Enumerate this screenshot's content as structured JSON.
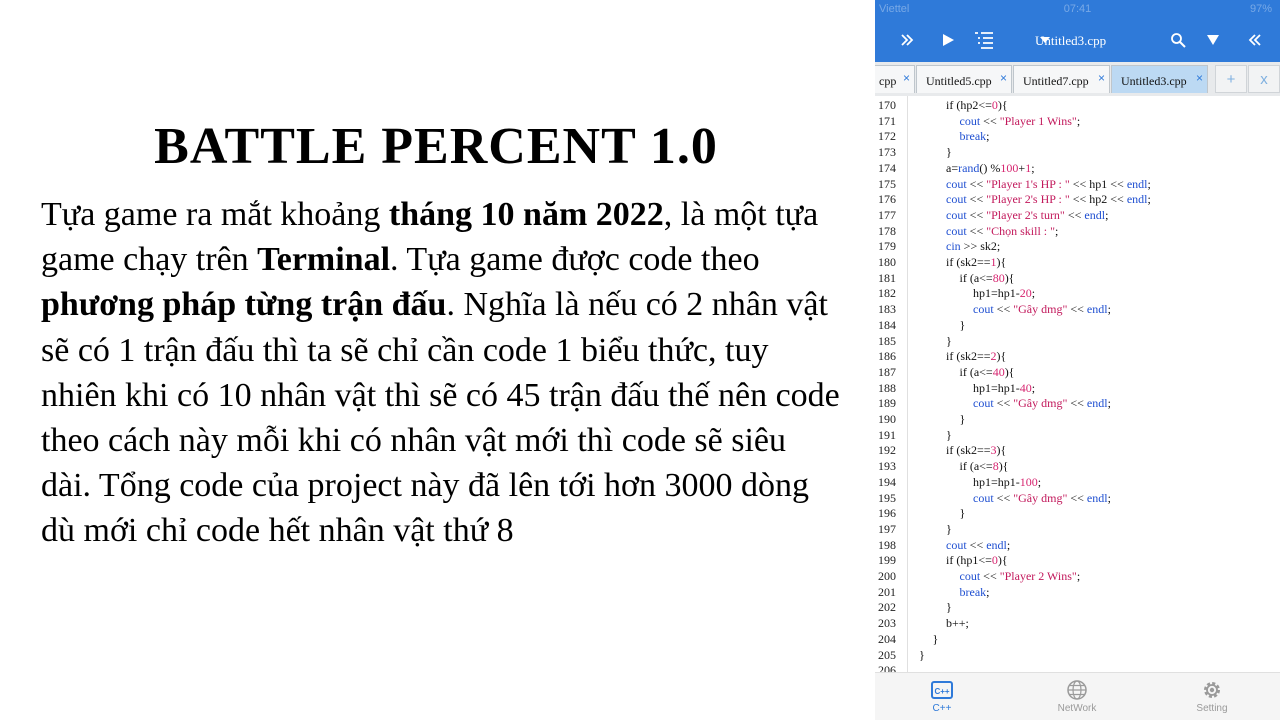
{
  "slide": {
    "title": "BATTLE PERCENT 1.0",
    "body": [
      {
        "text": "Tựa game ra mắt khoảng ",
        "bold": false
      },
      {
        "text": "tháng 10 năm 2022",
        "bold": true
      },
      {
        "text": ", là một tựa game chạy trên ",
        "bold": false
      },
      {
        "text": "Terminal",
        "bold": true
      },
      {
        "text": ". Tựa game được code theo ",
        "bold": false
      },
      {
        "text": "phương pháp từng trận đấu",
        "bold": true
      },
      {
        "text": ". Nghĩa là nếu có 2 nhân vật sẽ có 1 trận đấu thì ta sẽ chỉ cần code 1 biểu thức, tuy nhiên khi có 10 nhân vật thì sẽ có 45 trận đấu thế nên code theo cách này mỗi khi có nhân vật mới thì code sẽ siêu dài. Tổng code của project này đã lên tới hơn 3000 dòng dù mới chỉ code hết nhân vật thứ 8",
        "bold": false
      }
    ]
  },
  "status_bar": {
    "carrier": "Viettel",
    "time": "07:41",
    "battery": "97%"
  },
  "toolbar": {
    "file_title": "Untitled3.cpp",
    "icons": [
      "skip-forward-icon",
      "play-icon",
      "list-icon",
      "dropdown-caret-icon",
      "search-icon",
      "arrow-down-icon",
      "collapse-icon"
    ]
  },
  "tabs": [
    {
      "label": "cpp",
      "active": false,
      "close": "×"
    },
    {
      "label": "Untitled5.cpp",
      "active": false,
      "close": "×"
    },
    {
      "label": "Untitled7.cpp",
      "active": false,
      "close": "×"
    },
    {
      "label": "Untitled3.cpp",
      "active": true,
      "close": "×"
    }
  ],
  "tab_actions": {
    "add": "+",
    "close": "x"
  },
  "code": [
    {
      "n": "170",
      "indent": 3,
      "tokens": [
        [
          "kw",
          "if (hp2<="
        ],
        [
          "num",
          "0"
        ],
        [
          "kw",
          ")"
        ],
        [
          "kw",
          "{"
        ]
      ]
    },
    {
      "n": "171",
      "indent": 4,
      "tokens": [
        [
          "fn",
          "cout"
        ],
        [
          "kw",
          " << "
        ],
        [
          "str",
          "\"Player 1 Wins\""
        ],
        [
          "kw",
          ";"
        ]
      ]
    },
    {
      "n": "172",
      "indent": 4,
      "tokens": [
        [
          "fn",
          "break"
        ],
        [
          "kw",
          ";"
        ]
      ]
    },
    {
      "n": "173",
      "indent": 3,
      "tokens": [
        [
          "kw",
          "}"
        ]
      ]
    },
    {
      "n": "174",
      "indent": 3,
      "tokens": [
        [
          "kw",
          "a="
        ],
        [
          "fn",
          "rand"
        ],
        [
          "kw",
          "() %"
        ],
        [
          "num",
          "100"
        ],
        [
          "kw",
          "+"
        ],
        [
          "num",
          "1"
        ],
        [
          "kw",
          ";"
        ]
      ]
    },
    {
      "n": "175",
      "indent": 3,
      "tokens": [
        [
          "fn",
          "cout"
        ],
        [
          "kw",
          " << "
        ],
        [
          "str",
          "\"Player 1's HP : \""
        ],
        [
          "kw",
          " << hp1 << "
        ],
        [
          "fn",
          "endl"
        ],
        [
          "kw",
          ";"
        ]
      ]
    },
    {
      "n": "176",
      "indent": 3,
      "tokens": [
        [
          "fn",
          "cout"
        ],
        [
          "kw",
          " << "
        ],
        [
          "str",
          "\"Player 2's HP : \""
        ],
        [
          "kw",
          " << hp2 << "
        ],
        [
          "fn",
          "endl"
        ],
        [
          "kw",
          ";"
        ]
      ]
    },
    {
      "n": "177",
      "indent": 3,
      "tokens": [
        [
          "fn",
          "cout"
        ],
        [
          "kw",
          " << "
        ],
        [
          "str",
          "\"Player 2's turn\""
        ],
        [
          "kw",
          " << "
        ],
        [
          "fn",
          "endl"
        ],
        [
          "kw",
          ";"
        ]
      ]
    },
    {
      "n": "178",
      "indent": 3,
      "tokens": [
        [
          "fn",
          "cout"
        ],
        [
          "kw",
          " << "
        ],
        [
          "str",
          "\"Chọn skill : \""
        ],
        [
          "kw",
          ";"
        ]
      ]
    },
    {
      "n": "179",
      "indent": 3,
      "tokens": [
        [
          "fn",
          "cin"
        ],
        [
          "kw",
          " >> sk2;"
        ]
      ]
    },
    {
      "n": "180",
      "indent": 3,
      "tokens": [
        [
          "kw",
          "if (sk2=="
        ],
        [
          "num",
          "1"
        ],
        [
          "kw",
          "){"
        ]
      ]
    },
    {
      "n": "181",
      "indent": 4,
      "tokens": [
        [
          "kw",
          "if (a<="
        ],
        [
          "num",
          "80"
        ],
        [
          "kw",
          "){"
        ]
      ]
    },
    {
      "n": "182",
      "indent": 5,
      "tokens": [
        [
          "kw",
          "hp1=hp1-"
        ],
        [
          "num",
          "20"
        ],
        [
          "kw",
          ";"
        ]
      ]
    },
    {
      "n": "183",
      "indent": 5,
      "tokens": [
        [
          "fn",
          "cout"
        ],
        [
          "kw",
          " << "
        ],
        [
          "str",
          "\"Gây dmg\""
        ],
        [
          "kw",
          " << "
        ],
        [
          "fn",
          "endl"
        ],
        [
          "kw",
          ";"
        ]
      ]
    },
    {
      "n": "184",
      "indent": 4,
      "tokens": [
        [
          "kw",
          "}"
        ]
      ]
    },
    {
      "n": "185",
      "indent": 3,
      "tokens": [
        [
          "kw",
          "}"
        ]
      ]
    },
    {
      "n": "186",
      "indent": 3,
      "tokens": [
        [
          "kw",
          "if (sk2=="
        ],
        [
          "num",
          "2"
        ],
        [
          "kw",
          "){"
        ]
      ]
    },
    {
      "n": "187",
      "indent": 4,
      "tokens": [
        [
          "kw",
          "if (a<="
        ],
        [
          "num",
          "40"
        ],
        [
          "kw",
          "){"
        ]
      ]
    },
    {
      "n": "188",
      "indent": 5,
      "tokens": [
        [
          "kw",
          "hp1=hp1-"
        ],
        [
          "num",
          "40"
        ],
        [
          "kw",
          ";"
        ]
      ]
    },
    {
      "n": "189",
      "indent": 5,
      "tokens": [
        [
          "fn",
          "cout"
        ],
        [
          "kw",
          " << "
        ],
        [
          "str",
          "\"Gây dmg\""
        ],
        [
          "kw",
          " << "
        ],
        [
          "fn",
          "endl"
        ],
        [
          "kw",
          ";"
        ]
      ]
    },
    {
      "n": "190",
      "indent": 4,
      "tokens": [
        [
          "kw",
          "}"
        ]
      ]
    },
    {
      "n": "191",
      "indent": 3,
      "tokens": [
        [
          "kw",
          "}"
        ]
      ]
    },
    {
      "n": "192",
      "indent": 3,
      "tokens": [
        [
          "kw",
          "if (sk2=="
        ],
        [
          "num",
          "3"
        ],
        [
          "kw",
          "){"
        ]
      ]
    },
    {
      "n": "193",
      "indent": 4,
      "tokens": [
        [
          "kw",
          "if (a<="
        ],
        [
          "num",
          "8"
        ],
        [
          "kw",
          "){"
        ]
      ]
    },
    {
      "n": "194",
      "indent": 5,
      "tokens": [
        [
          "kw",
          "hp1=hp1-"
        ],
        [
          "num",
          "100"
        ],
        [
          "kw",
          ";"
        ]
      ]
    },
    {
      "n": "195",
      "indent": 5,
      "tokens": [
        [
          "fn",
          "cout"
        ],
        [
          "kw",
          " << "
        ],
        [
          "str",
          "\"Gây dmg\""
        ],
        [
          "kw",
          " << "
        ],
        [
          "fn",
          "endl"
        ],
        [
          "kw",
          ";"
        ]
      ]
    },
    {
      "n": "196",
      "indent": 4,
      "tokens": [
        [
          "kw",
          "}"
        ]
      ]
    },
    {
      "n": "197",
      "indent": 3,
      "tokens": [
        [
          "kw",
          "}"
        ]
      ]
    },
    {
      "n": "198",
      "indent": 3,
      "tokens": [
        [
          "fn",
          "cout"
        ],
        [
          "kw",
          " << "
        ],
        [
          "fn",
          "endl"
        ],
        [
          "kw",
          ";"
        ]
      ]
    },
    {
      "n": "199",
      "indent": 3,
      "tokens": [
        [
          "kw",
          "if (hp1<="
        ],
        [
          "num",
          "0"
        ],
        [
          "kw",
          "){"
        ]
      ]
    },
    {
      "n": "200",
      "indent": 4,
      "tokens": [
        [
          "fn",
          "cout"
        ],
        [
          "kw",
          " << "
        ],
        [
          "str",
          "\"Player 2 Wins\""
        ],
        [
          "kw",
          ";"
        ]
      ]
    },
    {
      "n": "201",
      "indent": 4,
      "tokens": [
        [
          "fn",
          "break"
        ],
        [
          "kw",
          ";"
        ]
      ]
    },
    {
      "n": "202",
      "indent": 3,
      "tokens": [
        [
          "kw",
          "}"
        ]
      ]
    },
    {
      "n": "203",
      "indent": 3,
      "tokens": [
        [
          "kw",
          "b++;"
        ]
      ]
    },
    {
      "n": "204",
      "indent": 2,
      "tokens": [
        [
          "kw",
          "}"
        ]
      ]
    },
    {
      "n": "205",
      "indent": 1,
      "tokens": [
        [
          "kw",
          "}"
        ]
      ]
    },
    {
      "n": "206",
      "indent": 0,
      "tokens": []
    }
  ],
  "bottom_nav": [
    {
      "label": "C++",
      "icon": "cpp-icon",
      "active": true
    },
    {
      "label": "NetWork",
      "icon": "globe-icon",
      "active": false
    },
    {
      "label": "Setting",
      "icon": "gear-icon",
      "active": false
    }
  ],
  "colors": {
    "accent": "#2f7ad9",
    "string": "#c2185b",
    "function": "#1f4fd1",
    "active_tab": "#bcd9f3"
  }
}
